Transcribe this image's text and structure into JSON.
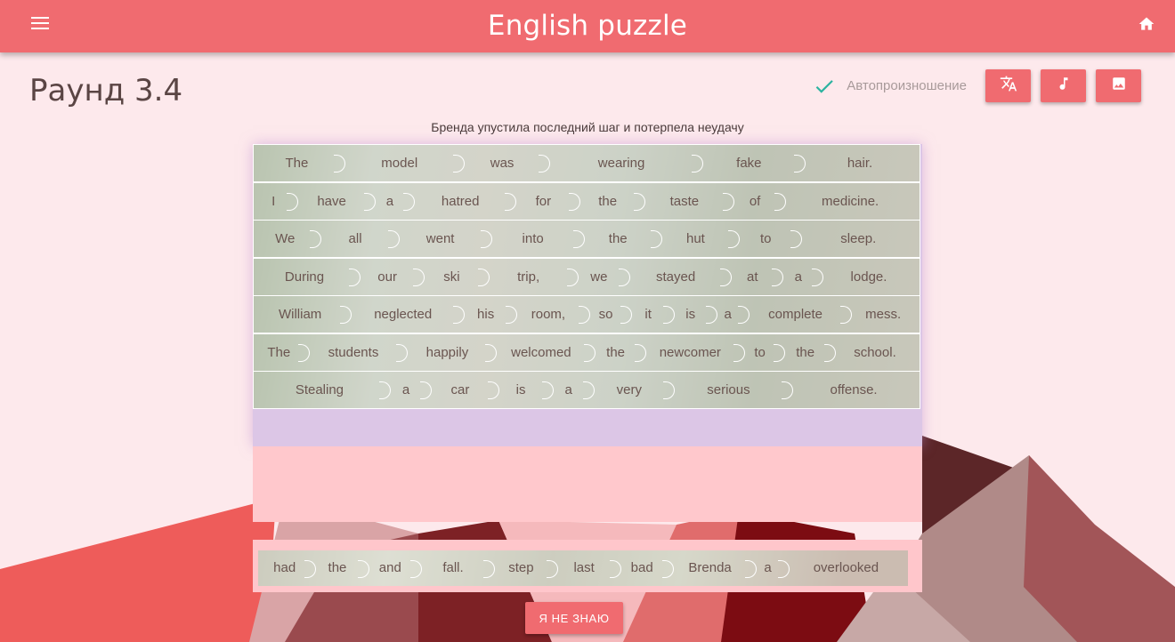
{
  "header": {
    "title": "English puzzle",
    "menu_icon": "menu-icon",
    "home_icon": "home-icon"
  },
  "round": {
    "title": "Раунд 3.4"
  },
  "toolbar": {
    "auto_pronounce_label": "Автопроизношение",
    "auto_pronounce_checked": true,
    "buttons": [
      "translate-icon",
      "music-note-icon",
      "image-icon"
    ]
  },
  "hint": "Бренда упустила последний шаг и потерпела неудачу",
  "rows": [
    [
      "The",
      "model",
      "was",
      "wearing",
      "fake",
      "hair."
    ],
    [
      "I",
      "have",
      "a",
      "hatred",
      "for",
      "the",
      "taste",
      "of",
      "medicine."
    ],
    [
      "We",
      "all",
      "went",
      "into",
      "the",
      "hut",
      "to",
      "sleep."
    ],
    [
      "During",
      "our",
      "ski",
      "trip,",
      "we",
      "stayed",
      "at",
      "a",
      "lodge."
    ],
    [
      "William",
      "neglected",
      "his",
      "room,",
      "so",
      "it",
      "is",
      "a",
      "complete",
      "mess."
    ],
    [
      "The",
      "students",
      "happily",
      "welcomed",
      "the",
      "newcomer",
      "to",
      "the",
      "school."
    ],
    [
      "Stealing",
      "a",
      "car",
      "is",
      "a",
      "very",
      "serious",
      "offense."
    ]
  ],
  "source_words": [
    "had",
    "the",
    "and",
    "fall.",
    "step",
    "last",
    "bad",
    "Brenda",
    "a",
    "overlooked"
  ],
  "dont_know_label": "Я НЕ ЗНАЮ",
  "colors": {
    "accent": "#f06b70",
    "background": "#fde9ec",
    "check": "#2bb3a0"
  }
}
